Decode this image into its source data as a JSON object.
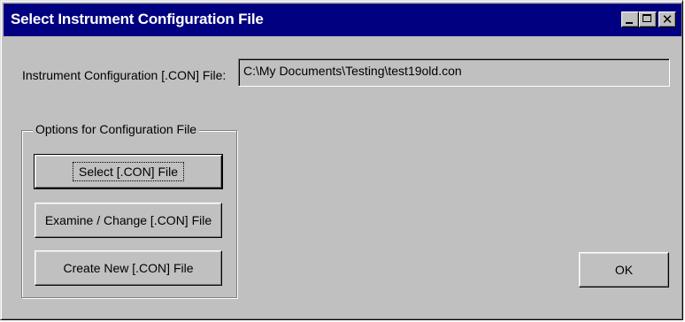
{
  "window": {
    "title": "Select Instrument Configuration File",
    "caption_buttons": [
      "minimize-icon",
      "maximize-icon",
      "close-icon"
    ],
    "close_glyph": "✕"
  },
  "file": {
    "label": "Instrument Configuration [.CON] File:",
    "value": "C:\\My Documents\\Testing\\test19old.con"
  },
  "options": {
    "legend": "Options for Configuration File",
    "select_label": "Select [.CON] File",
    "examine_label": "Examine / Change [.CON] File",
    "create_label": "Create New [.CON] File"
  },
  "dialog": {
    "ok_label": "OK"
  },
  "colors": {
    "title_bar": "#000080",
    "face": "#c0c0c0"
  }
}
